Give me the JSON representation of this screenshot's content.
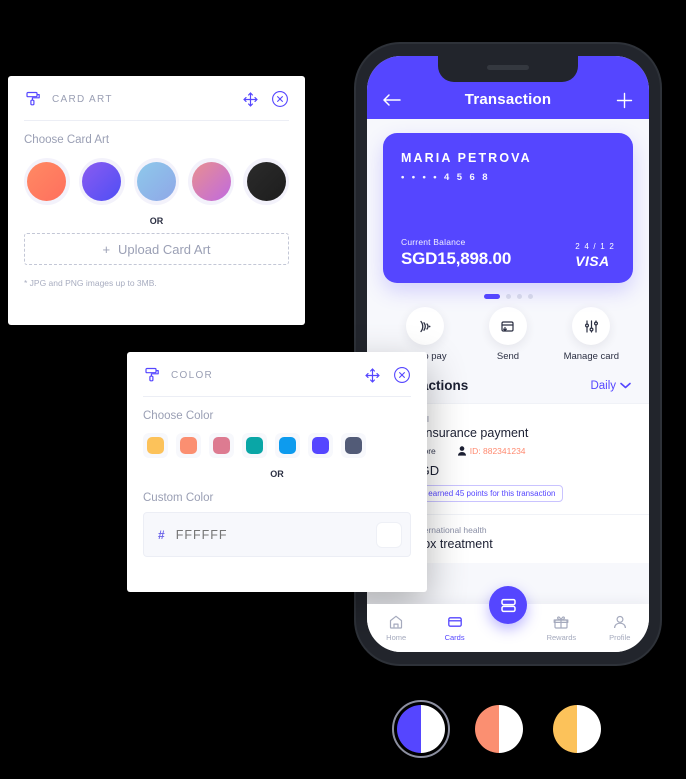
{
  "theme": {
    "accent": "#5546ff",
    "panel_bg": "#ffffff",
    "screen_bg": "#f7f8fc",
    "page_bg": "#000000"
  },
  "card_art_panel": {
    "icon": "paint-roller-icon",
    "title": "CARD ART",
    "move_icon": "move-arrows-icon",
    "close_icon": "close-circle-icon",
    "choose_label": "Choose Card Art",
    "swatches": [
      {
        "name": "coral-gradient",
        "css": "linear-gradient(135deg,#ff8a63 0%,#ff6f5e 100%)"
      },
      {
        "name": "violet-gradient",
        "css": "linear-gradient(135deg,#8a5cf0 0%,#4f4ef5 100%)"
      },
      {
        "name": "sky-gradient",
        "css": "linear-gradient(135deg,#8ec9ea 0%,#8fa7e8 100%)"
      },
      {
        "name": "pink-gradient",
        "css": "linear-gradient(135deg,#e88f8f 0%,#c06ae0 100%)"
      },
      {
        "name": "black-solid",
        "css": "linear-gradient(135deg,#2b2b2b 0%,#1d1d1d 100%)"
      }
    ],
    "or_text": "OR",
    "upload_label": "Upload Card Art",
    "upload_plus": "+",
    "note": "* JPG and PNG images up to 3MB."
  },
  "color_panel": {
    "icon": "paint-roller-icon",
    "title": "COLOR",
    "move_icon": "move-arrows-icon",
    "close_icon": "close-circle-icon",
    "choose_label": "Choose Color",
    "swatches": [
      {
        "name": "amber",
        "hex": "#fcc25a"
      },
      {
        "name": "coral",
        "hex": "#fb8f71"
      },
      {
        "name": "rose",
        "hex": "#dd7b91"
      },
      {
        "name": "teal",
        "hex": "#0aa6a6"
      },
      {
        "name": "blue",
        "hex": "#0d9bee"
      },
      {
        "name": "indigo",
        "hex": "#5546ff"
      },
      {
        "name": "slate",
        "hex": "#525b77"
      }
    ],
    "or_text": "OR",
    "custom_label": "Custom Color",
    "hash": "#",
    "custom_placeholder": "FFFFFF",
    "custom_value": "",
    "preview_hex": "#ffffff"
  },
  "phone": {
    "header": {
      "title": "Transaction",
      "back_icon": "back-arrow-icon",
      "add_icon": "plus-icon"
    },
    "card": {
      "holder_name": "MARIA PETROVA",
      "number_masked": "• • • •  4 5 6 8",
      "balance_label": "Current Balance",
      "balance_value": "SGD15,898.00",
      "expiry": "2 4 / 1 2",
      "brand": "VISA",
      "bg": "#5546ff"
    },
    "carousel": {
      "total_dots": 4,
      "active_index": 0
    },
    "actions": [
      {
        "name": "tap-to-pay",
        "label": "Tap to pay",
        "icon": "contactless-icon"
      },
      {
        "name": "send",
        "label": "Send",
        "icon": "send-card-icon"
      },
      {
        "name": "manage-card",
        "label": "Manage card",
        "icon": "sliders-icon"
      }
    ],
    "transactions_section": {
      "heading": "Transactions",
      "filter_label": "Daily",
      "filter_icon": "chevron-down-icon"
    },
    "transactions": [
      {
        "category": "Gift - Travel",
        "title": "Travel insurance payment",
        "location": "Singapore",
        "location_icon": "pin-icon",
        "id_label": "ID: 882341234",
        "id_icon": "person-icon",
        "amount": "- 45 SGD",
        "badge": "You have earned 45 points for this transaction"
      },
      {
        "category": "Claim - International health",
        "title": "Smallpox treatment",
        "location": "",
        "location_icon": "",
        "id_label": "",
        "id_icon": "",
        "amount": "",
        "badge": ""
      }
    ],
    "bottom_nav": [
      {
        "name": "home",
        "label": "Home",
        "icon": "home-icon",
        "active": false
      },
      {
        "name": "cards",
        "label": "Cards",
        "icon": "card-icon",
        "active": true
      },
      {
        "name": "rewards",
        "label": "Rewards",
        "icon": "gift-icon",
        "active": false
      },
      {
        "name": "profile",
        "label": "Profile",
        "icon": "person-icon",
        "active": false
      }
    ],
    "fab": {
      "name": "scan-fab",
      "icon": "card-scan-icon"
    }
  },
  "bottom_swatches": [
    {
      "name": "blue-white-split",
      "left": "#5546ff",
      "right": "#ffffff",
      "selected": true
    },
    {
      "name": "coral-white-split",
      "left": "#fb8f71",
      "right": "#ffffff",
      "selected": false
    },
    {
      "name": "amber-white-split",
      "left": "#fcc25a",
      "right": "#ffffff",
      "selected": false
    }
  ]
}
